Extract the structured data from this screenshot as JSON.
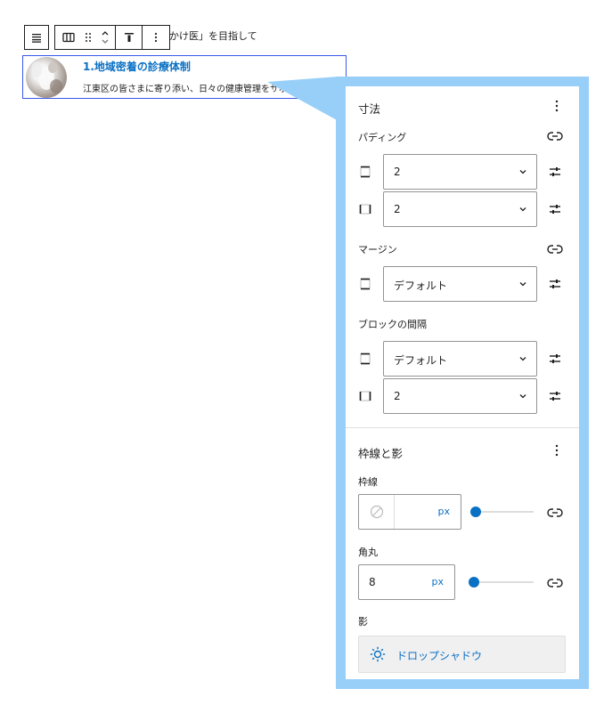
{
  "editor": {
    "heading_prefix": "「",
    "heading_suffix": "かけ医」を目指して",
    "list_item": {
      "title": "1.地域密着の診療体制",
      "description": "江東区の皆さまに寄り添い、日々の健康管理をサポートします。"
    }
  },
  "toolbar": {
    "block_icon": "list-icon",
    "transform_icon": "columns-icon",
    "drag_icon": "drag-handle-icon",
    "move_icon": "chevron-up-down-icon",
    "align_icon": "align-top-icon",
    "options_icon": "more-vertical-icon"
  },
  "dimensions": {
    "title": "寸法",
    "padding": {
      "label": "パディング",
      "vertical_value": "2",
      "horizontal_value": "2"
    },
    "margin": {
      "label": "マージン",
      "vertical_value": "デフォルト"
    },
    "block_spacing": {
      "label": "ブロックの間隔",
      "vertical_value": "デフォルト",
      "horizontal_value": "2"
    }
  },
  "border_shadow": {
    "title": "枠線と影",
    "border": {
      "label": "枠線",
      "unit": "px",
      "value": ""
    },
    "radius": {
      "label": "角丸",
      "value": "8",
      "unit": "px"
    },
    "shadow": {
      "label": "影",
      "button_label": "ドロップシャドウ"
    }
  },
  "colors": {
    "accent": "#0a70c4",
    "panel_frame": "#97cff9",
    "selection_border": "#3858e9"
  }
}
